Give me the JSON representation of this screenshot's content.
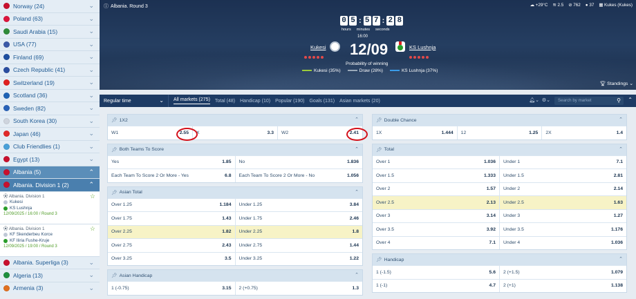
{
  "sidebar": {
    "items": [
      {
        "label": "Norway (24)",
        "flag": "#c8102e"
      },
      {
        "label": "Poland (63)",
        "flag": "#dc143c"
      },
      {
        "label": "Saudi Arabia (15)",
        "flag": "#2e8b3a"
      },
      {
        "label": "USA (77)",
        "flag": "#3c5aa8"
      },
      {
        "label": "Finland (69)",
        "flag": "#1f4fa0"
      },
      {
        "label": "Czech Republic (41)",
        "flag": "#2a4da0"
      },
      {
        "label": "Switzerland (19)",
        "flag": "#e02020"
      },
      {
        "label": "Scotland (36)",
        "flag": "#1f63b5"
      },
      {
        "label": "Sweden (82)",
        "flag": "#2962b8"
      },
      {
        "label": "South Korea (30)",
        "flag": "#cfd5de"
      },
      {
        "label": "Japan (46)",
        "flag": "#e12a2a"
      },
      {
        "label": "Club Friendlies (1)",
        "flag": "#49a0d8"
      },
      {
        "label": "Egypt (13)",
        "flag": "#c8102e"
      }
    ],
    "active": {
      "label": "Albania (5)"
    },
    "sub": {
      "label": "Albania. Division 1 (2)"
    },
    "matches": [
      {
        "league": "Albania. Division 1",
        "team1": "Kukesi",
        "team2": "KS Lushnja",
        "datetime": "12/09/2025 / 16:00 / Round 3"
      },
      {
        "league": "Albania. Division 1",
        "team1": "KF Skenderbeu Korce",
        "team2": "KF Iliria Fushe-Kruje",
        "datetime": "12/09/2025 / 19:00 / Round 3"
      }
    ],
    "bottom": [
      {
        "label": "Albania. Superliga (3)",
        "flag": "#c8102e"
      },
      {
        "label": "Algeria (13)",
        "flag": "#1f8f3e"
      },
      {
        "label": "Armenia (3)",
        "flag": "#e07020"
      }
    ]
  },
  "hero": {
    "title": "Albania. Round 3",
    "weather": [
      "+29°C",
      "2.5",
      "762",
      "37",
      "Kukes (Kukes)"
    ],
    "digits": [
      "0",
      "5",
      "5",
      "7",
      "2",
      "8"
    ],
    "labels": [
      "hours",
      "minutes",
      "seconds"
    ],
    "kickoff": "16:00",
    "score": "12/09",
    "team1": "Kukesi",
    "team2": "KS Lushnja",
    "prob_title": "Probability of winning",
    "prob": [
      {
        "label": "Kukesi (35%)",
        "color": "#9ccb3b"
      },
      {
        "label": "Draw (28%)",
        "color": "#9aa9b9"
      },
      {
        "label": "KS Lushnja (37%)",
        "color": "#3a9be8"
      }
    ],
    "standings": "Standings"
  },
  "marketbar": {
    "regular": "Regular time",
    "tabs": [
      "All markets (275)",
      "Total (48)",
      "Handicap (10)",
      "Popular (190)",
      "Goals (131)",
      "Asian markets (20)"
    ],
    "search_placeholder": "Search by market"
  },
  "left": [
    {
      "title": "1X2",
      "rows": [
        [
          {
            "l": "W1",
            "o": "2.55",
            "circle": true
          },
          {
            "l": "X",
            "o": "3.3"
          },
          {
            "l": "W2",
            "o": "2.41",
            "circle": true
          }
        ]
      ]
    },
    {
      "title": "Both Teams To Score",
      "rows": [
        [
          {
            "l": "Yes",
            "o": "1.85"
          },
          {
            "l": "No",
            "o": "1.836"
          }
        ],
        [
          {
            "l": "Each Team To Score 2 Or More - Yes",
            "o": "6.8"
          },
          {
            "l": "Each Team To Score 2 Or More - No",
            "o": "1.056"
          }
        ]
      ]
    },
    {
      "title": "Asian Total",
      "rows": [
        [
          {
            "l": "Over 1.25",
            "o": "1.184"
          },
          {
            "l": "Under 1.25",
            "o": "3.84"
          }
        ],
        [
          {
            "l": "Over 1.75",
            "o": "1.43"
          },
          {
            "l": "Under 1.75",
            "o": "2.46"
          }
        ],
        [
          {
            "l": "Over 2.25",
            "o": "1.82",
            "hl": true
          },
          {
            "l": "Under 2.25",
            "o": "1.8",
            "hl": true
          }
        ],
        [
          {
            "l": "Over 2.75",
            "o": "2.43"
          },
          {
            "l": "Under 2.75",
            "o": "1.44"
          }
        ],
        [
          {
            "l": "Over 3.25",
            "o": "3.5"
          },
          {
            "l": "Under 3.25",
            "o": "1.22"
          }
        ]
      ]
    },
    {
      "title": "Asian Handicap",
      "rows": [
        [
          {
            "l": "1 (-0.75)",
            "o": "3.15"
          },
          {
            "l": "2 (+0.75)",
            "o": "1.3"
          }
        ]
      ]
    }
  ],
  "right": [
    {
      "title": "Double Chance",
      "rows": [
        [
          {
            "l": "1X",
            "o": "1.444"
          },
          {
            "l": "12",
            "o": "1.25"
          },
          {
            "l": "2X",
            "o": "1.4"
          }
        ]
      ]
    },
    {
      "title": "Total",
      "rows": [
        [
          {
            "l": "Over 1",
            "o": "1.036"
          },
          {
            "l": "Under 1",
            "o": "7.1"
          }
        ],
        [
          {
            "l": "Over 1.5",
            "o": "1.333"
          },
          {
            "l": "Under 1.5",
            "o": "2.81"
          }
        ],
        [
          {
            "l": "Over 2",
            "o": "1.57"
          },
          {
            "l": "Under 2",
            "o": "2.14"
          }
        ],
        [
          {
            "l": "Over 2.5",
            "o": "2.13",
            "hl": true
          },
          {
            "l": "Under 2.5",
            "o": "1.63",
            "hl": true
          }
        ],
        [
          {
            "l": "Over 3",
            "o": "3.14"
          },
          {
            "l": "Under 3",
            "o": "1.27"
          }
        ],
        [
          {
            "l": "Over 3.5",
            "o": "3.92"
          },
          {
            "l": "Under 3.5",
            "o": "1.176"
          }
        ],
        [
          {
            "l": "Over 4",
            "o": "7.1"
          },
          {
            "l": "Under 4",
            "o": "1.036"
          }
        ]
      ]
    },
    {
      "title": "Handicap",
      "rows": [
        [
          {
            "l": "1 (-1.5)",
            "o": "5.6"
          },
          {
            "l": "2 (+1.5)",
            "o": "1.079"
          }
        ],
        [
          {
            "l": "1 (-1)",
            "o": "4.7"
          },
          {
            "l": "2 (+1)",
            "o": "1.138"
          }
        ]
      ]
    }
  ]
}
